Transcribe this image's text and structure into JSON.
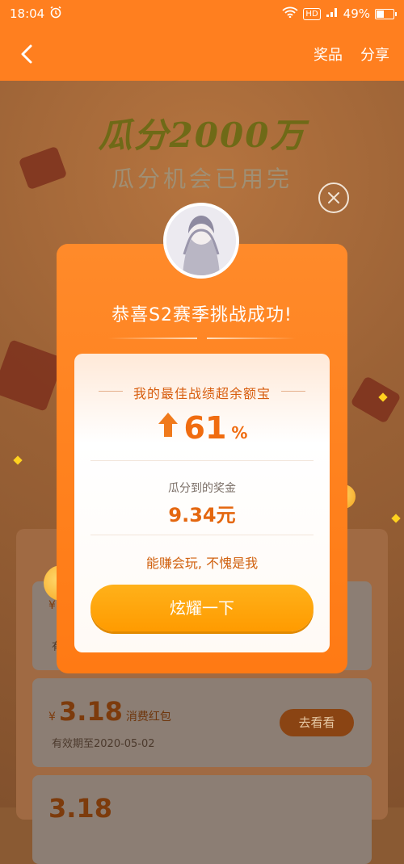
{
  "status_bar": {
    "time": "18:04",
    "alarm_icon": "alarm-icon",
    "wifi_icon": "wifi-icon",
    "hd_badge": "HD",
    "signal_icon": "signal-icon",
    "battery_percent": "49%",
    "battery_level": 0.49
  },
  "nav": {
    "back_icon": "chevron-left-icon",
    "actions": [
      "奖品",
      "分享"
    ]
  },
  "background": {
    "title": "瓜分2000万",
    "subtitle": "瓜分机会已用完",
    "coupons": [
      {
        "currency": "¥",
        "amount": "",
        "type": "",
        "expiry": "有",
        "button": ""
      },
      {
        "currency": "¥",
        "amount": "3.18",
        "type": "消费红包",
        "expiry": "有效期至2020-05-02",
        "button": "去看看"
      },
      {
        "currency": "",
        "amount": "3.18",
        "type": "",
        "expiry": "",
        "button": ""
      }
    ]
  },
  "modal": {
    "title": "恭喜S2赛季挑战成功!",
    "best_label": "我的最佳战绩超余额宝",
    "percent_value": "61",
    "percent_unit": "%",
    "prize_label": "瓜分到的奖金",
    "prize_value": "9.34元",
    "slogan": "能赚会玩, 不愧是我",
    "button_label": "炫耀一下",
    "close_icon": "close-circle-icon",
    "up_arrow_icon": "up-arrow-icon"
  },
  "colors": {
    "primary_orange": "#ff7f1f",
    "button_yellow": "#ff9b00",
    "text_orange": "#f06c10"
  }
}
